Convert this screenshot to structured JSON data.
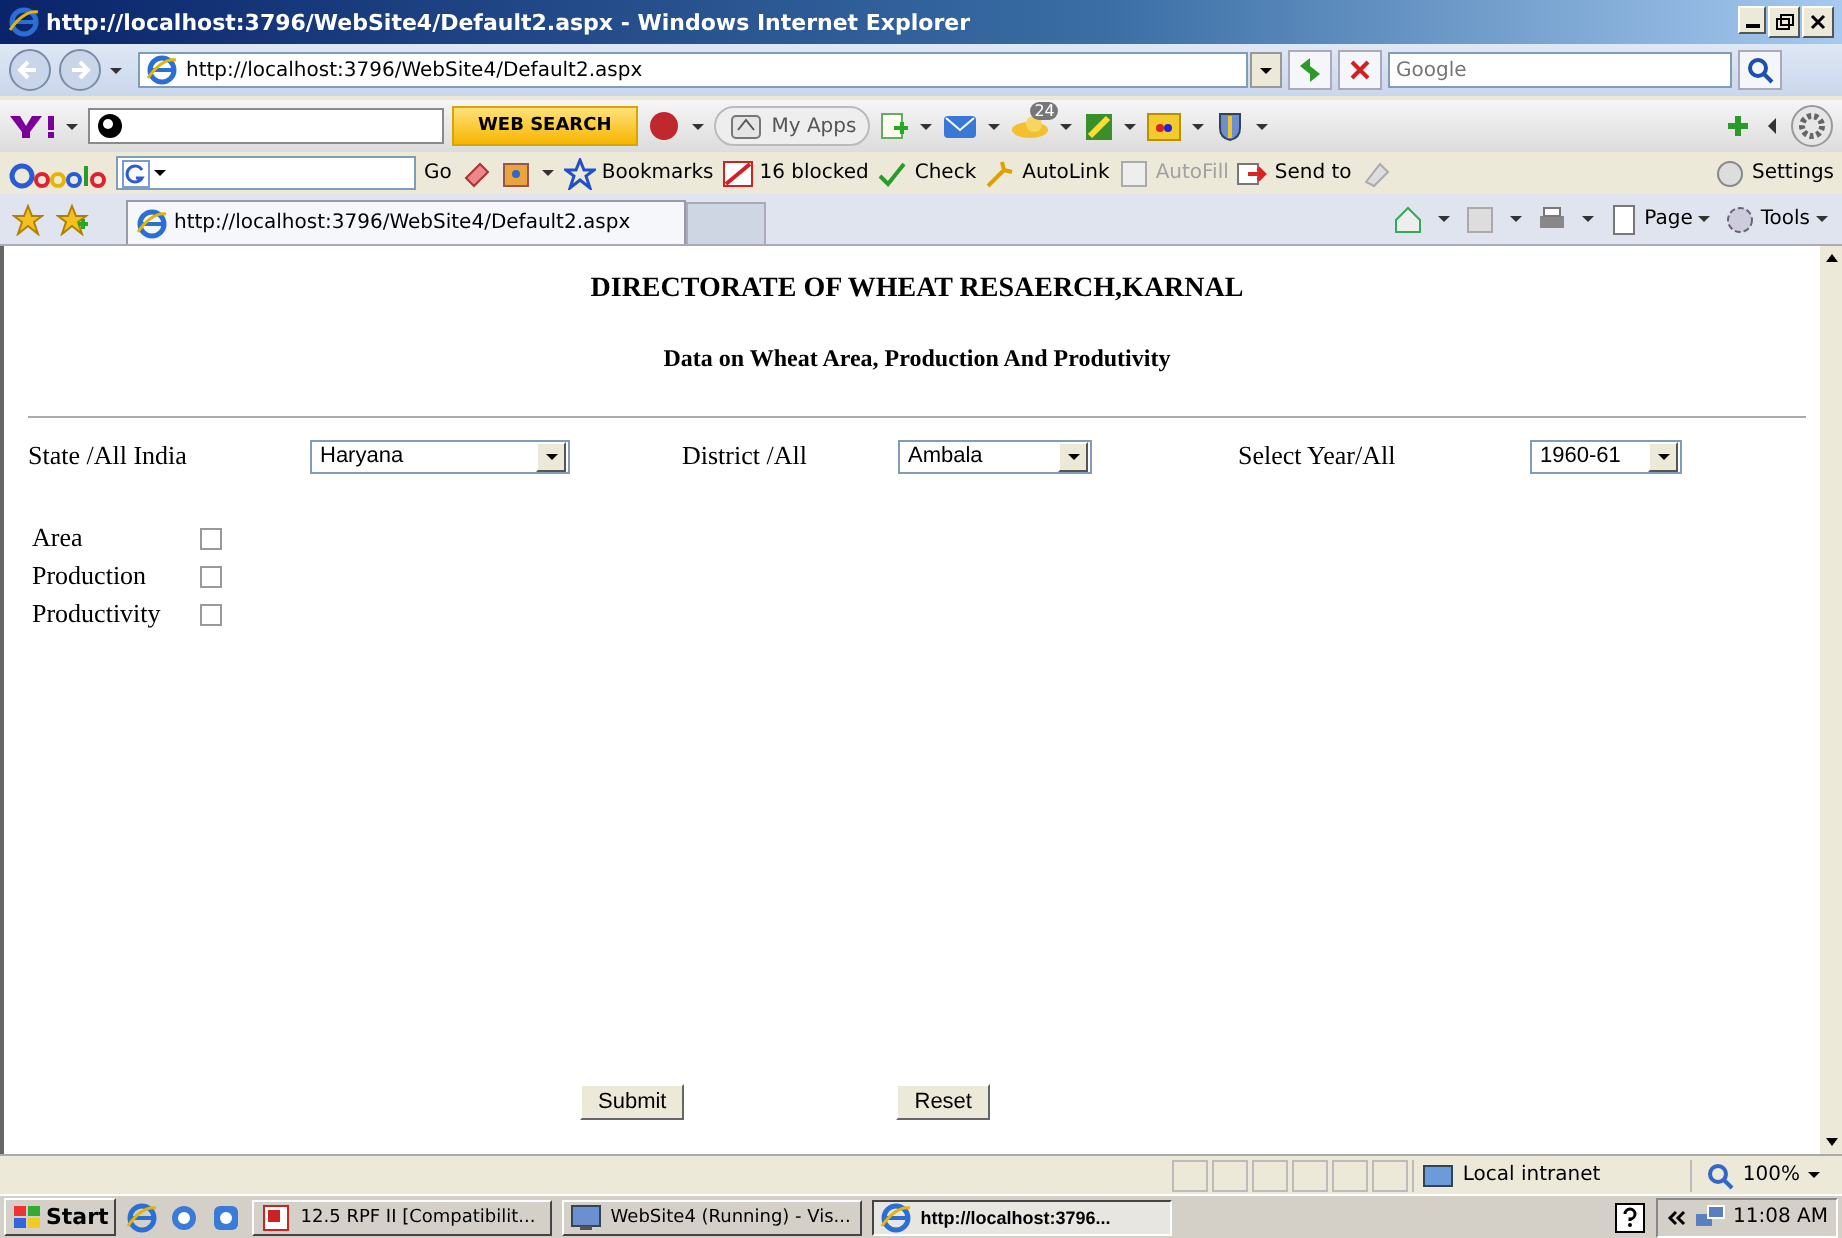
{
  "window": {
    "title": "http://localhost:3796/WebSite4/Default2.aspx - Windows Internet Explorer"
  },
  "address_bar": {
    "url": "http://localhost:3796/WebSite4/Default2.aspx"
  },
  "search_box": {
    "placeholder": "Google"
  },
  "yahoo_toolbar": {
    "search_button": "WEB SEARCH",
    "my_apps": "My Apps",
    "badge": "24"
  },
  "google_toolbar": {
    "go": "Go",
    "settings": "Settings",
    "items": [
      {
        "label": "Bookmarks",
        "disabled": false
      },
      {
        "label": "16 blocked",
        "disabled": false
      },
      {
        "label": "Check",
        "disabled": false
      },
      {
        "label": "AutoLink",
        "disabled": false
      },
      {
        "label": "AutoFill",
        "disabled": true
      },
      {
        "label": "Send to",
        "disabled": false
      }
    ]
  },
  "tab": {
    "title": "http://localhost:3796/WebSite4/Default2.aspx"
  },
  "command_bar": [
    "Page",
    "Tools"
  ],
  "page": {
    "heading": "DIRECTORATE OF WHEAT RESAERCH,KARNAL",
    "subheading": "Data on Wheat Area, Production And Produtivity",
    "filters": [
      {
        "label": "State /All India",
        "value": "Haryana"
      },
      {
        "label": "District /All",
        "value": "Ambala"
      },
      {
        "label": "Select Year/All",
        "value": "1960-61"
      }
    ],
    "options": [
      {
        "label": "Area",
        "checked": false
      },
      {
        "label": "Production",
        "checked": false
      },
      {
        "label": "Productivity",
        "checked": false
      }
    ],
    "buttons": [
      "Submit",
      "Reset"
    ]
  },
  "status_bar": {
    "zone": "Local intranet",
    "zoom": "100%"
  },
  "taskbar": {
    "start": "Start",
    "tasks": [
      {
        "label": "12.5 RPF II [Compatibilit...",
        "selected": false
      },
      {
        "label": "WebSite4 (Running) - Vis...",
        "selected": false
      },
      {
        "label": "http://localhost:3796...",
        "selected": true
      }
    ],
    "clock": "11:08 AM"
  }
}
